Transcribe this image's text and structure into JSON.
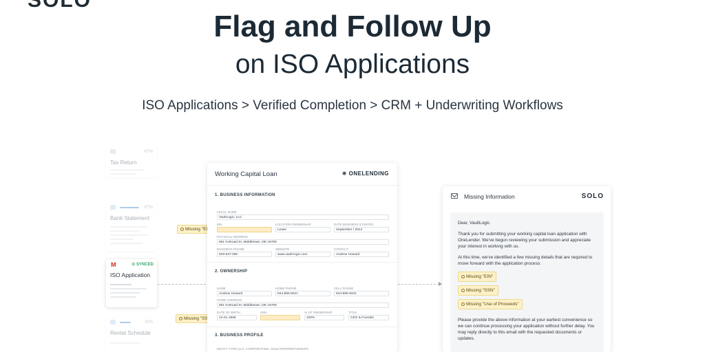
{
  "brand_logo": "SOLO",
  "headline": "Flag and Follow Up",
  "subheadline": "on ISO Applications",
  "flow_text": "ISO Applications > Verified Completion > CRM + Underwriting Workflows",
  "doc_cards": [
    {
      "title": "Tax Return",
      "pct": "67%"
    },
    {
      "title": "Bank Statement",
      "pct": "67%"
    },
    {
      "title": "ISO Application",
      "status": "SYNCED",
      "sub": "ISO Application"
    },
    {
      "title": "Rental Schedule",
      "pct": "32%"
    }
  ],
  "flags": {
    "ein": "Missing \"EIN\"",
    "ssn": "Missing \"SSN\""
  },
  "form": {
    "title": "Working Capital Loan",
    "brand": "ONELENDING",
    "sections": {
      "business": "1. BUSINESS INFORMATION",
      "ownership": "2. OWNERSHIP",
      "profile": "3. BUSINESS PROFILE"
    },
    "business": {
      "legal_name_label": "Legal Name",
      "legal_name": "VaultLogic, LLC",
      "ein_label": "EIN",
      "ein": "",
      "location_label": "Location Ownership",
      "location": "Lease",
      "started_label": "Date Business Started",
      "started": "September / 2014",
      "address_label": "Physical Address",
      "address": "651 N Broad St, Middletown, DE 19709",
      "phone_label": "Business Phone",
      "phone": "629-547-050",
      "website_label": "Website",
      "website": "www.vault-logic.com",
      "contact_label": "Contact",
      "contact": "Andrew Howard"
    },
    "owner": {
      "name_label": "Name",
      "name": "Andrew Howard",
      "home_phone_label": "Home Phone",
      "home_phone": "844-590-8421",
      "cell_label": "Cell Phone",
      "cell": "844-590-8421",
      "home_address_label": "Home Address",
      "home_address": "651 N Broad St, Middletown, DE 19709",
      "dob_label": "Date of Birth",
      "dob": "14-01-1998",
      "ssn_label": "SSN",
      "ssn": "",
      "own_label": "% of Ownership",
      "own": "100%",
      "title_label": "Title",
      "title": "CEO & Founder"
    },
    "profile_line": "ENTITY TYPE (LLC, CORPORATION, SOLE PROPRIETORSHIP)"
  },
  "email": {
    "header": "Missing Information",
    "brand": "SOLO",
    "greeting": "Dear, VaultLogic",
    "para1": "Thank you for submitting your working capital loan application with OneLender. We've begun reviewing your submission and appreciate your interest in working with us.",
    "para2": "At this time, we've identified a few missing details that are required to move forward with the application process:",
    "tags": [
      "Missing \"EIN\"",
      "Missing \"SSN\"",
      "Missing \"Use of Proceeds\""
    ],
    "para3": "Please provide the above information at your earliest convenience so we can continue processing your application without further delay. You may reply directly to this email with the requested documents or updates."
  },
  "colors": {
    "flag_bg": "#fdf1c9",
    "synced": "#3aa36c",
    "gmail_red": "#d93025"
  }
}
